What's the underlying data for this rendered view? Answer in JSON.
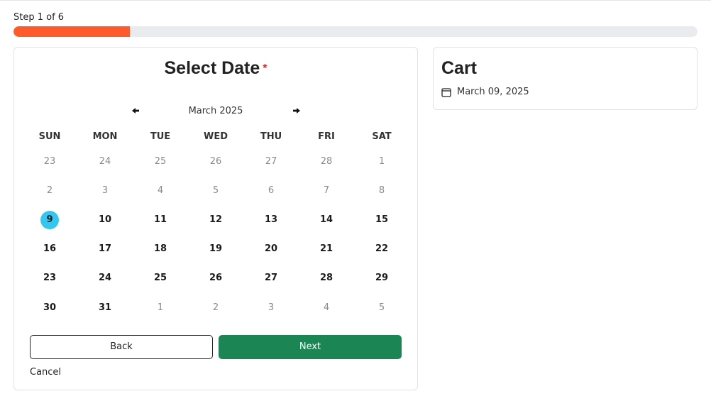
{
  "progress": {
    "step_text": "Step 1 of 6",
    "fraction": 0.17,
    "color": "#ff5a2c"
  },
  "date_picker": {
    "title": "Select Date",
    "required_mark": "*",
    "month_label": "March 2025",
    "prev_icon": "arrow-left-icon",
    "next_icon": "arrow-right-icon",
    "weekdays": [
      "SUN",
      "MON",
      "TUE",
      "WED",
      "THU",
      "FRI",
      "SAT"
    ],
    "weeks": [
      [
        {
          "d": "23",
          "s": "muted"
        },
        {
          "d": "24",
          "s": "muted"
        },
        {
          "d": "25",
          "s": "muted"
        },
        {
          "d": "26",
          "s": "muted"
        },
        {
          "d": "27",
          "s": "muted"
        },
        {
          "d": "28",
          "s": "muted"
        },
        {
          "d": "1",
          "s": "muted"
        }
      ],
      [
        {
          "d": "2",
          "s": "muted"
        },
        {
          "d": "3",
          "s": "muted"
        },
        {
          "d": "4",
          "s": "muted"
        },
        {
          "d": "5",
          "s": "muted"
        },
        {
          "d": "6",
          "s": "muted"
        },
        {
          "d": "7",
          "s": "muted"
        },
        {
          "d": "8",
          "s": "muted"
        }
      ],
      [
        {
          "d": "9",
          "s": "selected"
        },
        {
          "d": "10",
          "s": "active"
        },
        {
          "d": "11",
          "s": "active"
        },
        {
          "d": "12",
          "s": "active"
        },
        {
          "d": "13",
          "s": "active"
        },
        {
          "d": "14",
          "s": "active"
        },
        {
          "d": "15",
          "s": "active"
        }
      ],
      [
        {
          "d": "16",
          "s": "active"
        },
        {
          "d": "17",
          "s": "active"
        },
        {
          "d": "18",
          "s": "active"
        },
        {
          "d": "19",
          "s": "active"
        },
        {
          "d": "20",
          "s": "active"
        },
        {
          "d": "21",
          "s": "active"
        },
        {
          "d": "22",
          "s": "active"
        }
      ],
      [
        {
          "d": "23",
          "s": "active"
        },
        {
          "d": "24",
          "s": "active"
        },
        {
          "d": "25",
          "s": "active"
        },
        {
          "d": "26",
          "s": "active"
        },
        {
          "d": "27",
          "s": "active"
        },
        {
          "d": "28",
          "s": "active"
        },
        {
          "d": "29",
          "s": "active"
        }
      ],
      [
        {
          "d": "30",
          "s": "active"
        },
        {
          "d": "31",
          "s": "active"
        },
        {
          "d": "1",
          "s": "muted"
        },
        {
          "d": "2",
          "s": "muted"
        },
        {
          "d": "3",
          "s": "muted"
        },
        {
          "d": "4",
          "s": "muted"
        },
        {
          "d": "5",
          "s": "muted"
        }
      ]
    ],
    "back_label": "Back",
    "next_label": "Next",
    "cancel_label": "Cancel",
    "selected_color": "#33c7ef",
    "next_color": "#1b8653"
  },
  "cart": {
    "title": "Cart",
    "item_icon": "calendar-icon",
    "item_date": "March 09, 2025"
  }
}
